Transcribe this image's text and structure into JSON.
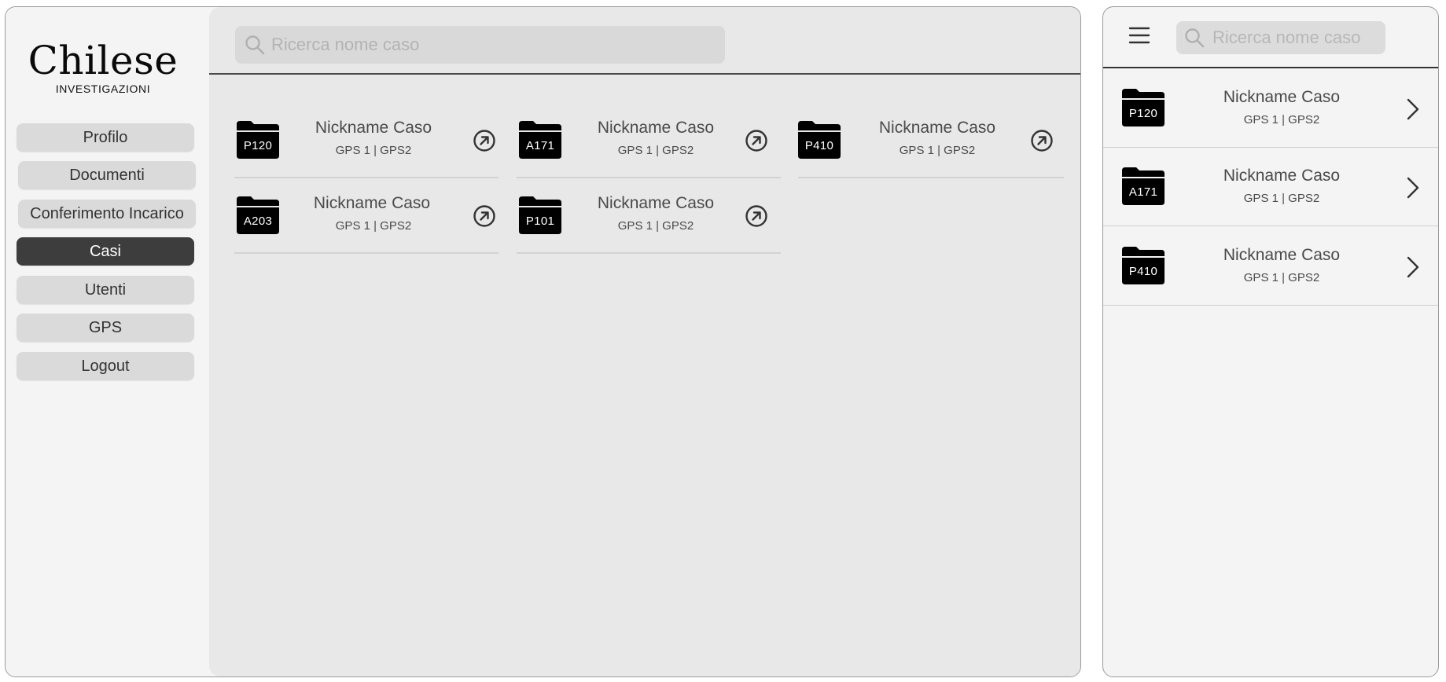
{
  "brand": {
    "name": "Chilese",
    "tagline": "INVESTIGAZIONI"
  },
  "nav": [
    {
      "label": "Profilo",
      "active": false
    },
    {
      "label": "Documenti",
      "active": false
    },
    {
      "label": "Conferimento Incarico",
      "active": false
    },
    {
      "label": "Casi",
      "active": true
    },
    {
      "label": "Utenti",
      "active": false
    },
    {
      "label": "GPS",
      "active": false
    },
    {
      "label": "Logout",
      "active": false
    }
  ],
  "search": {
    "placeholder": "Ricerca nome caso"
  },
  "cases": [
    {
      "code": "P120",
      "title": "Nickname Caso",
      "subtitle": "GPS 1 | GPS2"
    },
    {
      "code": "A171",
      "title": "Nickname Caso",
      "subtitle": "GPS 1 | GPS2"
    },
    {
      "code": "P410",
      "title": "Nickname Caso",
      "subtitle": "GPS 1 | GPS2"
    },
    {
      "code": "A203",
      "title": "Nickname Caso",
      "subtitle": "GPS 1 | GPS2"
    },
    {
      "code": "P101",
      "title": "Nickname Caso",
      "subtitle": "GPS 1 | GPS2"
    }
  ],
  "mobile": {
    "search": {
      "placeholder": "Ricerca nome caso"
    },
    "cases": [
      {
        "code": "P120",
        "title": "Nickname Caso",
        "subtitle": "GPS 1 | GPS2"
      },
      {
        "code": "A171",
        "title": "Nickname Caso",
        "subtitle": "GPS 1 | GPS2"
      },
      {
        "code": "P410",
        "title": "Nickname Caso",
        "subtitle": "GPS 1 | GPS2"
      }
    ]
  },
  "colors": {
    "active_nav": "#3d3d3d",
    "nav_bg": "#dadada",
    "main_bg": "#e8e8e8",
    "folder": "#000000"
  }
}
